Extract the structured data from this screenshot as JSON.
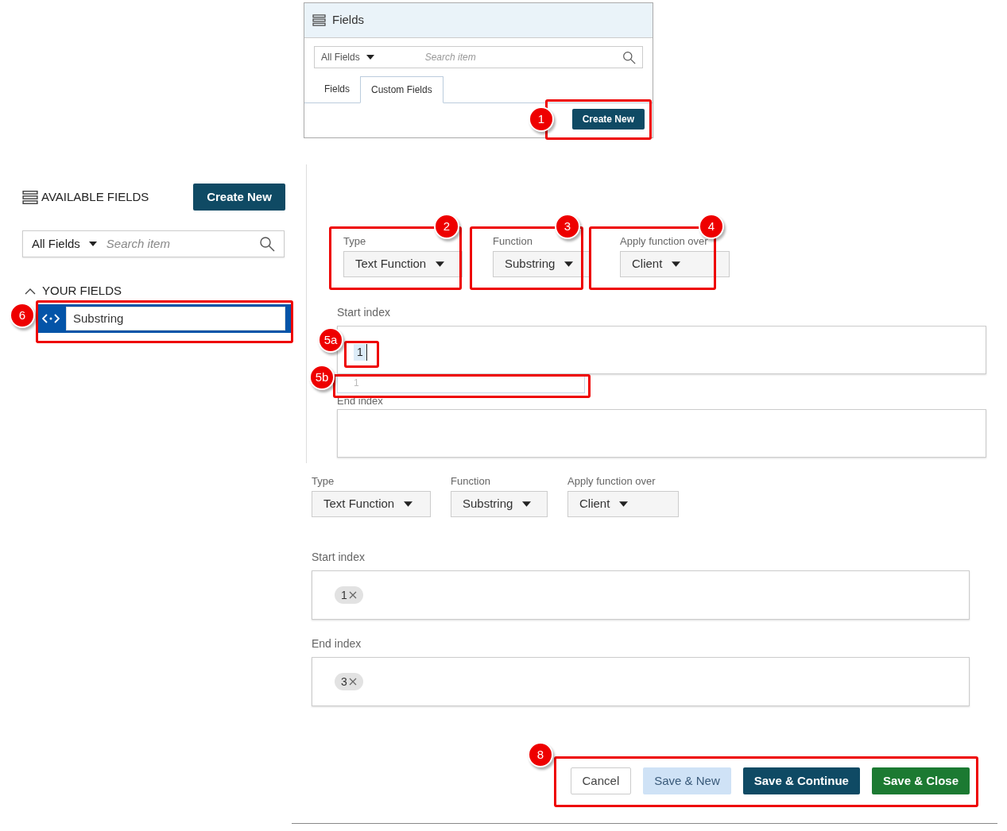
{
  "top_panel": {
    "title": "Fields",
    "filter": "All Fields",
    "search": {
      "placeholder": "Search item"
    },
    "tabs": [
      {
        "label": "Fields",
        "selected": false
      },
      {
        "label": "Custom Fields",
        "selected": true
      }
    ],
    "button": "Create New",
    "callout": "1"
  },
  "sidebar": {
    "title": "AVAILABLE FIELDS",
    "button": "Create New",
    "filter": "All Fields",
    "search": {
      "placeholder": "Search item"
    },
    "section": {
      "label": "YOUR FIELDS",
      "expanded": true
    },
    "items": [
      {
        "value": "Substring",
        "selected": true
      }
    ],
    "callout": "6"
  },
  "form_step": {
    "dropdowns": [
      {
        "label": "Type",
        "value": "Text Function",
        "callout": "2"
      },
      {
        "label": "Function",
        "value": "Substring",
        "callout": "3"
      },
      {
        "label": "Apply function over",
        "value": "Client",
        "callout": "4"
      }
    ],
    "start_index": {
      "label": "Start index",
      "value": "1",
      "callout": "5a"
    },
    "suggestion": {
      "value": "1",
      "callout": "5b"
    },
    "end_index": {
      "label": "End index"
    }
  },
  "form_result": {
    "dropdowns": [
      {
        "label": "Type",
        "value": "Text Function"
      },
      {
        "label": "Function",
        "value": "Substring"
      },
      {
        "label": "Apply function over",
        "value": "Client"
      }
    ],
    "fields": [
      {
        "label": "Start index",
        "tags": [
          "1"
        ]
      },
      {
        "label": "End index",
        "tags": [
          "3"
        ]
      }
    ]
  },
  "buttons": [
    {
      "label": "Cancel",
      "kind": "secondary"
    },
    {
      "label": "Save & New",
      "kind": "light"
    },
    {
      "label": "Save & Continue",
      "kind": "primary"
    },
    {
      "label": "Save & Close",
      "kind": "success"
    }
  ],
  "buttons_callout": "8"
}
